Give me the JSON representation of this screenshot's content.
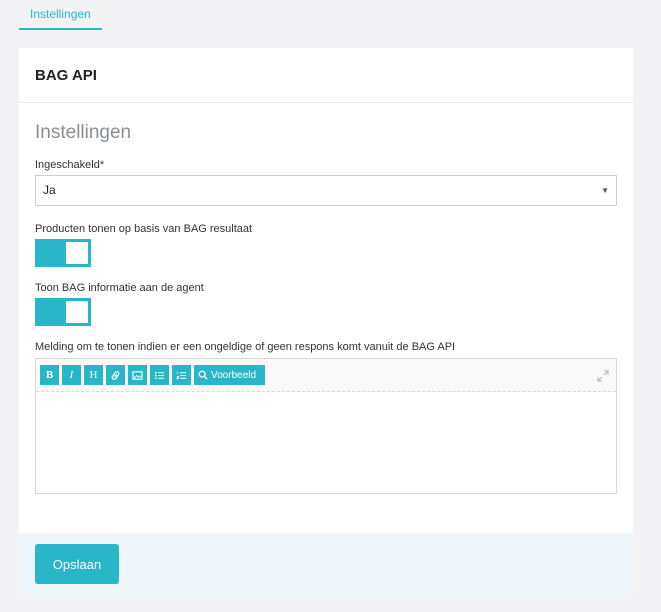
{
  "tabs": [
    {
      "label": "Instellingen",
      "active": true
    }
  ],
  "card": {
    "title": "BAG API"
  },
  "form": {
    "section_title": "Instellingen",
    "enabled": {
      "label": "Ingeschakeld*",
      "value": "Ja"
    },
    "show_products": {
      "label": "Producten tonen op basis van BAG resultaat",
      "on": true
    },
    "show_agent_info": {
      "label": "Toon BAG informatie aan de agent",
      "on": true
    },
    "message": {
      "label": "Melding om te tonen indien er een ongeldige of geen respons komt vanuit de BAG API",
      "value": "",
      "toolbar": {
        "bold": "B",
        "italic": "I",
        "heading": "H",
        "preview": "Voorbeeld"
      }
    }
  },
  "footer": {
    "save_label": "Opslaan"
  },
  "colors": {
    "accent": "#29b6c8",
    "footer_bg": "#eef6fb",
    "page_bg": "#f3f3f5"
  }
}
